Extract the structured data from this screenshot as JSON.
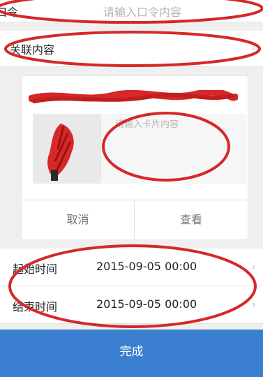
{
  "form": {
    "command": {
      "label": "口令",
      "placeholder": "请输入口令内容"
    },
    "related": {
      "label": "关联内容"
    },
    "card": {
      "placeholder": "请输入卡片内容",
      "cancel_label": "取消",
      "view_label": "查看"
    },
    "start": {
      "label": "起始时间",
      "value": "2015-09-05 00:00"
    },
    "end": {
      "label": "结束时间",
      "value": "2015-09-05 00:00"
    }
  },
  "footer": {
    "done_label": "完成"
  },
  "colors": {
    "accent": "#3a7fd0",
    "annotation": "#d62828"
  },
  "icons": [
    "chevron-right-icon"
  ]
}
